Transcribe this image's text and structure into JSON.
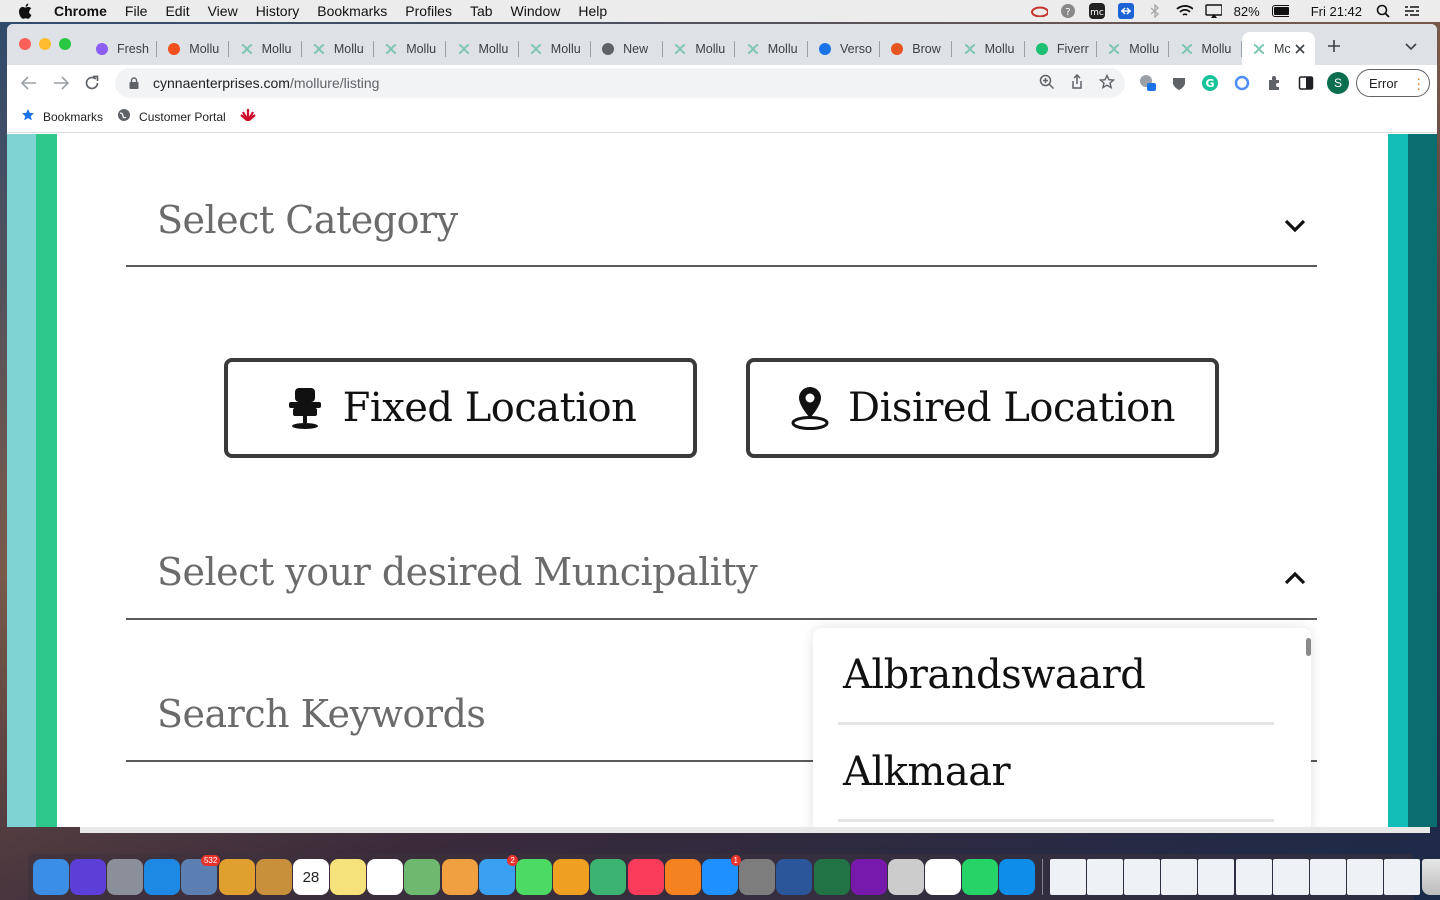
{
  "menubar": {
    "app": "Chrome",
    "items": [
      "File",
      "Edit",
      "View",
      "History",
      "Bookmarks",
      "Profiles",
      "Tab",
      "Window",
      "Help"
    ],
    "battery": "82%",
    "clock": "Fri 21:42"
  },
  "tabs": [
    {
      "label": "Fresh",
      "icon": "freshworks-icon",
      "color": "#8b5cf6"
    },
    {
      "label": "Mollu",
      "icon": "figma-icon",
      "color": "#f24e1e"
    },
    {
      "label": "Mollu",
      "icon": "mollure-icon",
      "color": "#7fc6b3"
    },
    {
      "label": "Mollu",
      "icon": "mollure-icon",
      "color": "#7fc6b3"
    },
    {
      "label": "Mollu",
      "icon": "mollure-icon",
      "color": "#7fc6b3"
    },
    {
      "label": "Mollu",
      "icon": "mollure-icon",
      "color": "#7fc6b3"
    },
    {
      "label": "Mollu",
      "icon": "mollure-icon",
      "color": "#7fc6b3"
    },
    {
      "label": "New",
      "icon": "chrome-icon",
      "color": "#5f6368"
    },
    {
      "label": "Mollu",
      "icon": "mollure-icon",
      "color": "#7fc6b3"
    },
    {
      "label": "Mollu",
      "icon": "mollure-icon",
      "color": "#7fc6b3"
    },
    {
      "label": "Verso",
      "icon": "info-icon",
      "color": "#1a73e8"
    },
    {
      "label": "Brow",
      "icon": "tw-icon",
      "color": "#e8541f"
    },
    {
      "label": "Mollu",
      "icon": "mollure-icon",
      "color": "#7fc6b3"
    },
    {
      "label": "Fiverr",
      "icon": "fiverr-icon",
      "color": "#1dbf73"
    },
    {
      "label": "Mollu",
      "icon": "mollure-icon",
      "color": "#7fc6b3"
    },
    {
      "label": "Mollu",
      "icon": "mollure-icon",
      "color": "#7fc6b3"
    },
    {
      "label": "Mollu",
      "icon": "mollure-icon",
      "color": "#7fc6b3"
    },
    {
      "label": "Mc",
      "icon": "mollure-icon",
      "color": "#7fc6b3"
    }
  ],
  "omnibox": {
    "host": "cynnaenterprises.com",
    "path": "/mollure/listing"
  },
  "profile_initial": "S",
  "error_label": "Error",
  "bookmarks": [
    {
      "label": "Bookmarks",
      "icon": "star-icon"
    },
    {
      "label": "Customer Portal",
      "icon": "globe-icon"
    },
    {
      "label": "",
      "icon": "huawei-icon"
    }
  ],
  "form": {
    "category_label": "Select Category",
    "fixed_location_label": "Fixed Location",
    "desired_location_label": "Disired Location",
    "municipality_label": "Select your desired Muncipality",
    "keywords_label": "Search Keywords"
  },
  "municipalities": [
    "Albrandswaard",
    "Alkmaar"
  ],
  "dock_items": [
    {
      "name": "finder"
    },
    {
      "name": "siri"
    },
    {
      "name": "launchpad"
    },
    {
      "name": "safari"
    },
    {
      "name": "preview",
      "badge": "532"
    },
    {
      "name": "keynote"
    },
    {
      "name": "contacts"
    },
    {
      "name": "calendar",
      "text": "28"
    },
    {
      "name": "notes"
    },
    {
      "name": "reminders"
    },
    {
      "name": "maps"
    },
    {
      "name": "photos"
    },
    {
      "name": "messages",
      "badge": "2"
    },
    {
      "name": "facetime"
    },
    {
      "name": "pages"
    },
    {
      "name": "numbers"
    },
    {
      "name": "music"
    },
    {
      "name": "books"
    },
    {
      "name": "app-store",
      "badge": "1"
    },
    {
      "name": "system-preferences"
    },
    {
      "name": "word"
    },
    {
      "name": "excel"
    },
    {
      "name": "onenote"
    },
    {
      "name": "help"
    },
    {
      "name": "chrome"
    },
    {
      "name": "whatsapp"
    },
    {
      "name": "teamviewer"
    }
  ],
  "colors": {
    "stripe_left_1": "#7fd3d3",
    "stripe_left_2": "#2cc98a",
    "stripe_right_1": "#13bdb8",
    "stripe_right_2": "#0a6d70"
  }
}
